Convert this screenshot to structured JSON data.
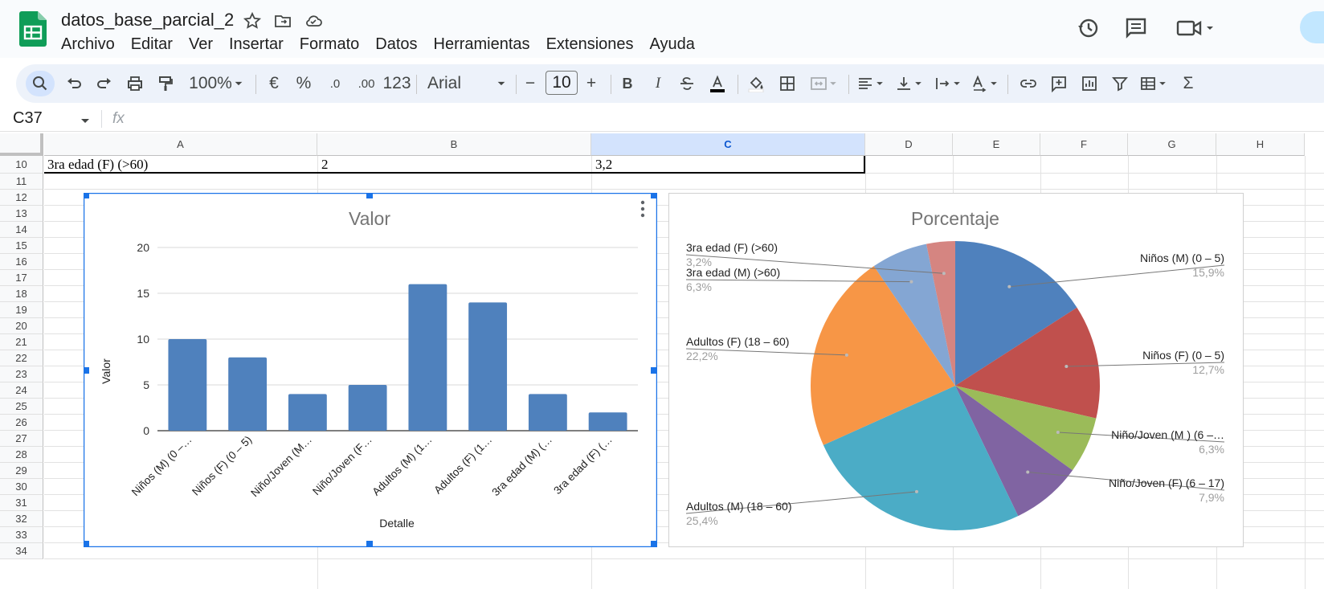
{
  "doc": {
    "title": "datos_base_parcial_2"
  },
  "menu": [
    "Archivo",
    "Editar",
    "Ver",
    "Insertar",
    "Formato",
    "Datos",
    "Herramientas",
    "Extensiones",
    "Ayuda"
  ],
  "toolbar": {
    "zoom": "100%",
    "currency": "€",
    "percent": "%",
    "dec_less": ".0",
    "dec_more": ".00",
    "format_123": "123",
    "font": "Arial",
    "font_size": "10",
    "minus": "−",
    "plus": "+",
    "bold": "B",
    "italic": "I",
    "sigma": "Σ"
  },
  "formula_bar": {
    "cell_ref": "C37",
    "fx": "fx",
    "value": ""
  },
  "columns": [
    "A",
    "B",
    "C",
    "D",
    "E",
    "F",
    "G",
    "H"
  ],
  "selected_column": "C",
  "rows": [
    "10",
    "11",
    "12",
    "13",
    "14",
    "15",
    "16",
    "17",
    "18",
    "19",
    "20",
    "21",
    "22",
    "23",
    "24",
    "25",
    "26",
    "27",
    "28",
    "29",
    "30",
    "31",
    "32",
    "33",
    "34"
  ],
  "row10": {
    "A": "3ra edad (F) (>60)",
    "B": "2",
    "C": "3,2"
  },
  "accent_color": "#1a73e8",
  "charts": {
    "bar_title": "Valor",
    "bar_xlabel": "Detalle",
    "bar_ylabel": "Valor",
    "pie_title": "Porcentaje"
  },
  "chart_data": [
    {
      "type": "bar",
      "title": "Valor",
      "xlabel": "Detalle",
      "ylabel": "Valor",
      "ylim": [
        0,
        20
      ],
      "yticks": [
        "0",
        "5",
        "10",
        "15",
        "20"
      ],
      "categories": [
        "Niños (M) (0 –…",
        "Niños (F) (0 – 5)",
        "Niño/Joven (M…",
        "Niño/Joven (F…",
        "Adultos (M) (1…",
        "Adultos (F) (1…",
        "3ra edad (M) (…",
        "3ra edad (F) (…"
      ],
      "values": [
        10,
        8,
        4,
        5,
        16,
        14,
        4,
        2
      ],
      "color": "#4f81bd",
      "grid": true
    },
    {
      "type": "pie",
      "title": "Porcentaje",
      "slices": [
        {
          "label": "Niños (M) (0 – 5)",
          "pct_text": "15,9%",
          "value": 15.9,
          "color": "#4f81bd"
        },
        {
          "label": "Niños (F) (0 – 5)",
          "pct_text": "12,7%",
          "value": 12.7,
          "color": "#c0504d"
        },
        {
          "label": "Niño/Joven (M ) (6 –…",
          "pct_text": "6,3%",
          "value": 6.3,
          "color": "#9bbb59"
        },
        {
          "label": "Niño/Joven (F) (6 – 17)",
          "pct_text": "7,9%",
          "value": 7.9,
          "color": "#8064a2"
        },
        {
          "label": "Adultos (M) (18 – 60)",
          "pct_text": "25,4%",
          "value": 25.4,
          "color": "#4bacc6"
        },
        {
          "label": "Adultos (F) (18 – 60)",
          "pct_text": "22,2%",
          "value": 22.2,
          "color": "#f79646"
        },
        {
          "label": "3ra edad (M) (>60)",
          "pct_text": "6,3%",
          "value": 6.3,
          "color": "#84a6d3"
        },
        {
          "label": "3ra edad (F) (>60)",
          "pct_text": "3,2%",
          "value": 3.2,
          "color": "#d58581"
        }
      ]
    }
  ]
}
